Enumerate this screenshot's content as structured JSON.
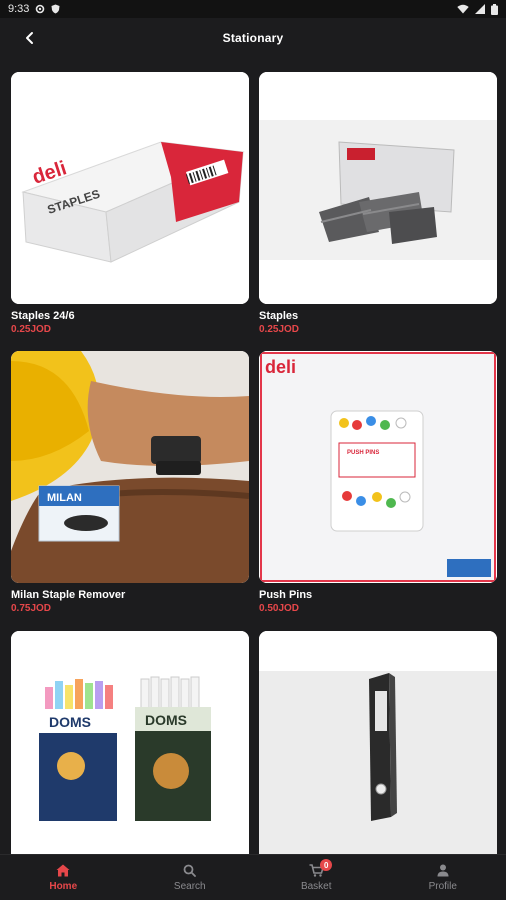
{
  "status_bar": {
    "time": "9:33"
  },
  "app_bar": {
    "title": "Stationary"
  },
  "products": [
    {
      "name": "Staples 24/6",
      "price": "0.25JOD"
    },
    {
      "name": "Staples",
      "price": "0.25JOD"
    },
    {
      "name": "Milan Staple Remover",
      "price": "0.75JOD"
    },
    {
      "name": "Push Pins",
      "price": "0.50JOD"
    },
    {
      "name": "",
      "price": ""
    },
    {
      "name": "",
      "price": ""
    }
  ],
  "image_text": {
    "deli_brand": "deli",
    "staples_label": "STAPLES",
    "milan_brand": "MILAN",
    "push_pins_label": "PUSH PINS",
    "doms_brand": "DOMS"
  },
  "bottom_nav": {
    "home": "Home",
    "search": "Search",
    "basket": "Basket",
    "basket_count": "0",
    "profile": "Profile"
  },
  "colors": {
    "accent": "#e6474a",
    "background": "#1c1c1e"
  }
}
